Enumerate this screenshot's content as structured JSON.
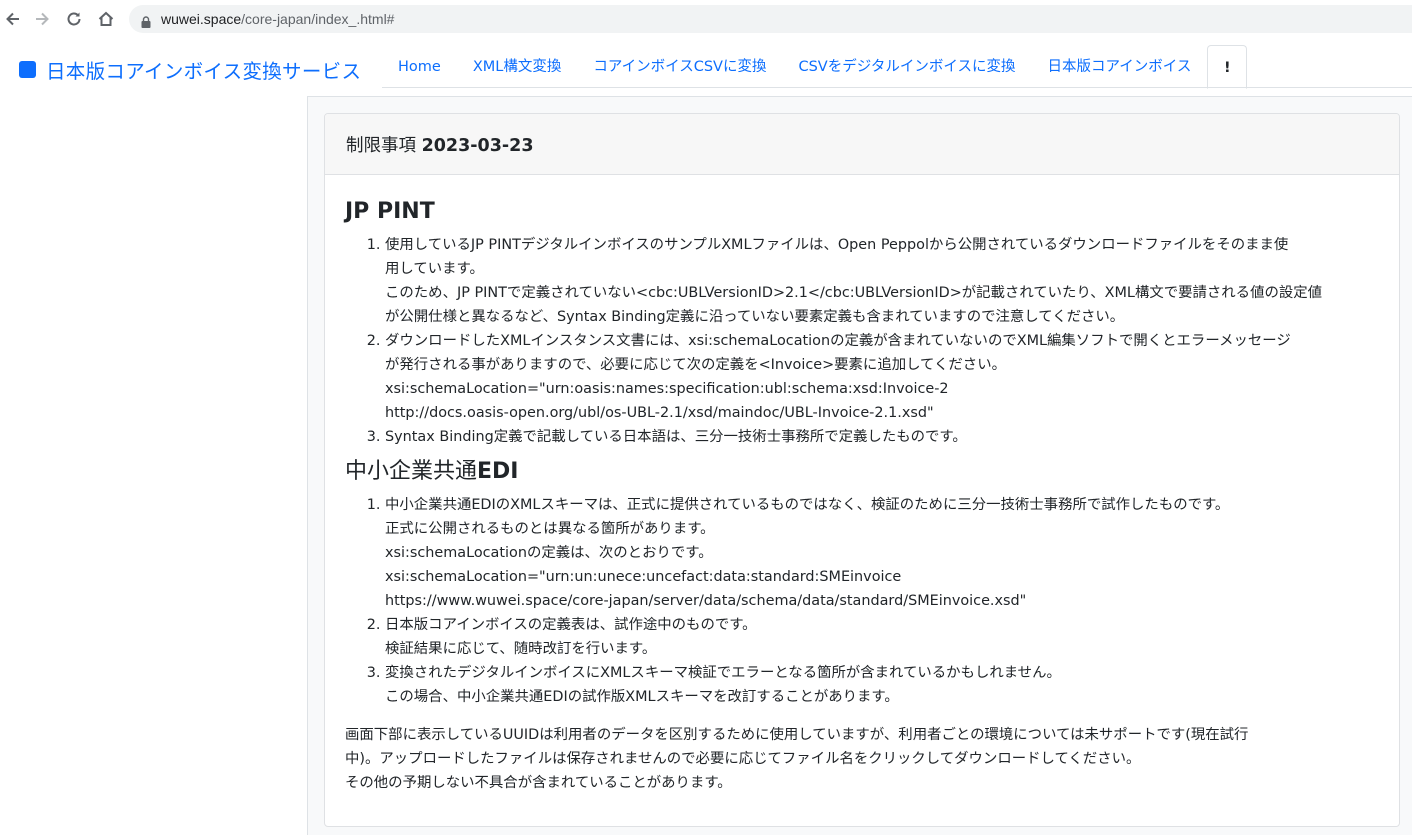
{
  "browser": {
    "url_host": "wuwei.space",
    "url_path": "/core-japan/index_.html#"
  },
  "brand": {
    "title": "日本版コアインボイス変換サービス",
    "color": "#0d6efd"
  },
  "tabs": [
    {
      "label": "Home"
    },
    {
      "label": "XML構文変換"
    },
    {
      "label": "コアインボイスCSVに変換"
    },
    {
      "label": "CSVをデジタルインボイスに変換"
    },
    {
      "label": "日本版コアインボイス"
    },
    {
      "label": "!"
    }
  ],
  "card": {
    "title_prefix": "制限事項 ",
    "title_date": "2023-03-23"
  },
  "sections": [
    {
      "heading": "JP PINT",
      "items": [
        {
          "lines": [
            "使用しているJP PINTデジタルインボイスのサンプルXMLファイルは、Open Peppolから公開されているダウンロードファイルをそのまま使",
            "用しています。",
            "このため、JP PINTで定義されていない<cbc:UBLVersionID>2.1</cbc:UBLVersionID>が記載されていたり、XML構文で要請される値の設定値",
            "が公開仕様と異なるなど、Syntax Binding定義に沿っていない要素定義も含まれていますので注意してください。"
          ]
        },
        {
          "lines": [
            "ダウンロードしたXMLインスタンス文書には、xsi:schemaLocationの定義が含まれていないのでXML編集ソフトで開くとエラーメッセージ",
            "が発行される事がありますので、必要に応じて次の定義を<Invoice>要素に追加してください。",
            "xsi:schemaLocation=\"urn:oasis:names:specification:ubl:schema:xsd:Invoice-2",
            "http://docs.oasis-open.org/ubl/os-UBL-2.1/xsd/maindoc/UBL-Invoice-2.1.xsd\""
          ]
        },
        {
          "lines": [
            "Syntax Binding定義で記載している日本語は、三分一技術士事務所で定義したものです。"
          ]
        }
      ]
    },
    {
      "heading_prefix": "中小企業共通",
      "heading_suffix": "EDI",
      "items": [
        {
          "lines": [
            "中小企業共通EDIのXMLスキーマは、正式に提供されているものではなく、検証のために三分一技術士事務所で試作したものです。",
            "正式に公開されるものとは異なる箇所があります。",
            "xsi:schemaLocationの定義は、次のとおりです。",
            "xsi:schemaLocation=\"urn:un:unece:uncefact:data:standard:SMEinvoice",
            "https://www.wuwei.space/core-japan/server/data/schema/data/standard/SMEinvoice.xsd\""
          ]
        },
        {
          "lines": [
            "日本版コアインボイスの定義表は、試作途中のものです。",
            "検証結果に応じて、随時改訂を行います。"
          ]
        },
        {
          "lines": [
            "変換されたデジタルインボイスにXMLスキーマ検証でエラーとなる箇所が含まれているかもしれません。",
            "この場合、中小企業共通EDIの試作版XMLスキーマを改訂することがあります。"
          ]
        }
      ]
    }
  ],
  "footer_note": {
    "lines": [
      "画面下部に表示しているUUIDは利用者のデータを区別するために使用していますが、利用者ごとの環境については未サポートです(現在試行",
      "中)。アップロードしたファイルは保存されませんので必要に応じてファイル名をクリックしてダウンロードしてください。",
      "その他の予期しない不具合が含まれていることがあります。"
    ]
  }
}
